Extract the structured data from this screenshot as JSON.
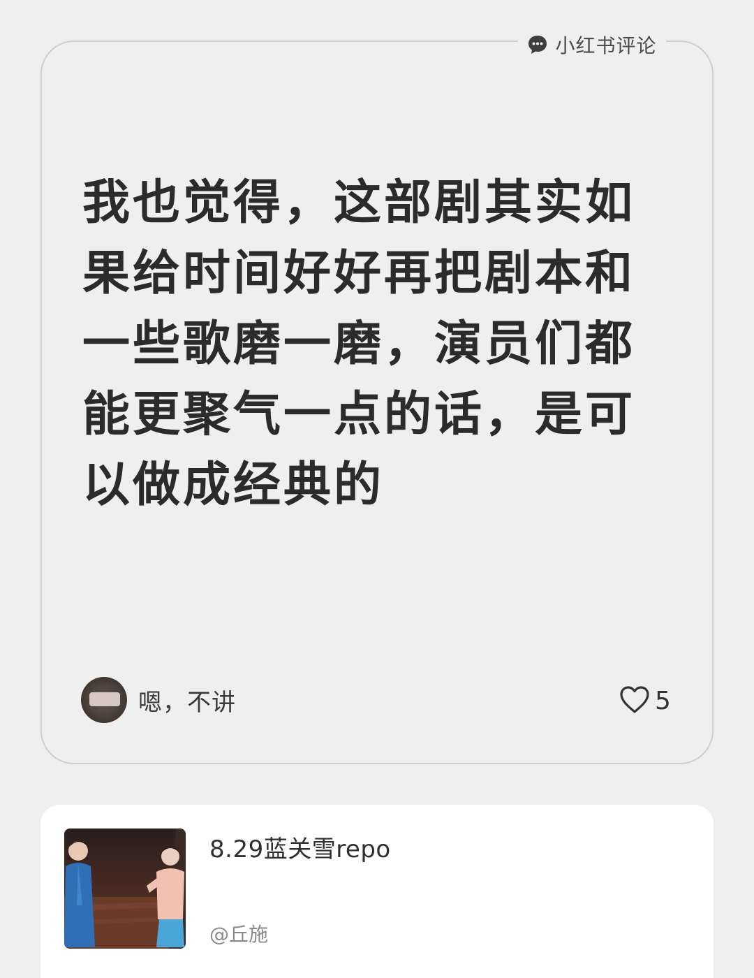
{
  "source": {
    "label": "小红书评论",
    "icon": "comment-bubble-icon"
  },
  "comment": {
    "text": "我也觉得，这部剧其实如果给时间好好再把剧本和一些歌磨一磨，演员们都能更聚气一点的话，是可以做成经典的",
    "author": "嗯，不讲",
    "likes": "5"
  },
  "note": {
    "title": "8.29蓝关雪repo",
    "author": "@丘施"
  }
}
